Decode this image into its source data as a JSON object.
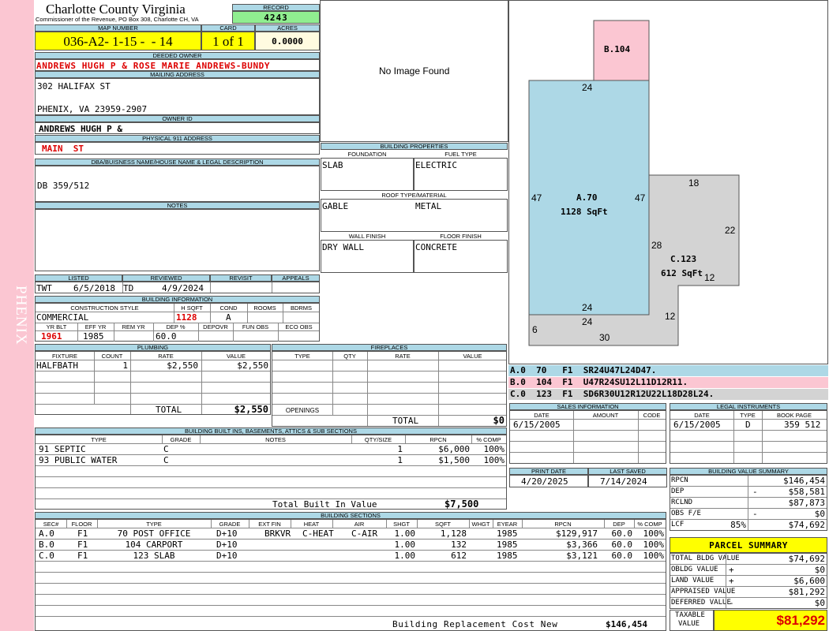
{
  "header": {
    "county": "Charlotte County Virginia",
    "commissioner": "Commissioner of the Revenue, PO Box 308, Charlotte CH, VA",
    "record_label": "RECORD",
    "record": "4243",
    "map_label": "MAP NUMBER",
    "map_number": "036-A2- 1-15 -  - 14",
    "card_label": "CARD",
    "card": "1 of 1",
    "acres_label": "ACRES",
    "acres": "0.0000"
  },
  "sidebar": {
    "label": "PHENIX"
  },
  "owner": {
    "deeded_label": "DEEDED OWNER",
    "deeded_owner": "ANDREWS HUGH P & ROSE MARIE ANDREWS-BUNDY",
    "mailing_label": "MAILING ADDRESS",
    "address1": "302 HALIFAX ST",
    "address2": "PHENIX, VA 23959-2907",
    "owner_id_label": "OWNER ID",
    "owner_id": "ANDREWS HUGH P &",
    "physical_label": "PHYSICAL 911 ADDRESS",
    "physical": "MAIN  ST",
    "dba_label": "DBA/BUISNESS NAME/HOUSE NAME & LEGAL DESCRIPTION",
    "dba": "DB 359/512",
    "notes_label": "NOTES"
  },
  "image": {
    "no_image": "No Image Found"
  },
  "building_props": {
    "title": "BUILDING PROPERTIES",
    "foundation_label": "FOUNDATION",
    "foundation": "SLAB",
    "fuel_label": "FUEL TYPE",
    "fuel": "ELECTRIC",
    "roof_label": "ROOF TYPE/MATERIAL",
    "roof_type": "GABLE",
    "roof_material": "METAL",
    "wall_label": "WALL FINISH",
    "wall": "DRY WALL",
    "floor_label": "FLOOR FINISH",
    "floor": "CONCRETE"
  },
  "listing": {
    "listed_label": "LISTED",
    "reviewed_label": "REVIEWED",
    "revisit_label": "REVISIT",
    "appeals_label": "APPEALS",
    "listed_by": "TWT",
    "listed_date": "6/5/2018",
    "reviewed_by": "TD",
    "reviewed_date": "4/9/2024"
  },
  "building_info": {
    "title": "BUILDING INFORMATION",
    "style_label": "CONSTRUCTION STYLE",
    "hsqft_label": "H SQFT",
    "cond_label": "COND",
    "rooms_label": "ROOMS",
    "bdrms_label": "BDRMS",
    "style": "COMMERCIAL",
    "hsqft": "1128",
    "cond": "A",
    "yrblt_label": "YR BLT",
    "effyr_label": "EFF YR",
    "remyr_label": "REM YR",
    "dep_label": "DEP %",
    "depovr_label": "DEPOVR",
    "funobs_label": "FUN OBS",
    "ecoobs_label": "ECO OBS",
    "yrblt": "1961",
    "effyr": "1985",
    "dep": "60.0"
  },
  "plumbing": {
    "title": "PLUMBING",
    "headers": [
      "FIXTURE",
      "COUNT",
      "RATE",
      "VALUE"
    ],
    "rows": [
      [
        "HALFBATH",
        "1",
        "$2,550",
        "$2,550"
      ]
    ],
    "total_label": "TOTAL",
    "total": "$2,550"
  },
  "fireplaces": {
    "title": "FIREPLACES",
    "headers": [
      "TYPE",
      "QTY",
      "RATE",
      "VALUE"
    ],
    "openings_label": "OPENINGS",
    "total_label": "TOTAL",
    "total": "$0"
  },
  "builtins": {
    "title": "BUILDING BUILT INS, BASEMENTS, ATTICS & SUB SECTIONS",
    "headers": [
      "TYPE",
      "GRADE",
      "NOTES",
      "QTY/SIZE",
      "RPCN",
      "% COMP"
    ],
    "rows": [
      [
        "91 SEPTIC",
        "C",
        "",
        "1",
        "$6,000",
        "100%"
      ],
      [
        "93 PUBLIC WATER",
        "C",
        "",
        "1",
        "$1,500",
        "100%"
      ]
    ],
    "total_label": "Total Built In Value",
    "total": "$7,500"
  },
  "sections": {
    "title": "BUILDING SECTIONS",
    "headers": [
      "SEC#",
      "FLOOR",
      "TYPE",
      "GRADE",
      "EXT FIN",
      "HEAT",
      "AIR",
      "SHGT",
      "SQFT",
      "WHGT",
      "EYEAR",
      "RPCN",
      "DEP",
      "% COMP"
    ],
    "rows": [
      [
        "A.0",
        "F1",
        "70 POST OFFICE",
        "D+10",
        "BRKVR",
        "C-HEAT",
        "C-AIR",
        "1.00",
        "1,128",
        "",
        "1985",
        "$129,917",
        "60.0",
        "100%"
      ],
      [
        "B.0",
        "F1",
        "104 CARPORT",
        "D+10",
        "",
        "",
        "",
        "1.00",
        "132",
        "",
        "1985",
        "$3,366",
        "60.0",
        "100%"
      ],
      [
        "C.0",
        "F1",
        "123 SLAB",
        "D+10",
        "",
        "",
        "",
        "1.00",
        "612",
        "",
        "1985",
        "$3,121",
        "60.0",
        "100%"
      ]
    ],
    "rcn_label": "Building Replacement Cost New",
    "rcn": "$146,454"
  },
  "sketch": {
    "a_label": "A.70",
    "a_area": "1128 SqFt",
    "b_label": "B.104",
    "c_label": "C.123",
    "c_area": "612 SqFt",
    "dims": [
      "24",
      "47",
      "47",
      "24",
      "18",
      "22",
      "28",
      "12",
      "12",
      "6",
      "24",
      "30"
    ]
  },
  "legend": [
    {
      "text": "A.0  70   F1  SR24U47L24D47.",
      "color": "#add8e6"
    },
    {
      "text": "B.0  104  F1  U47R24SU12L11D12R11.",
      "color": "#fbc6d2"
    },
    {
      "text": "C.0  123  F1  SD6R30U12R12U22L18D28L24.",
      "color": "#d3d3d3"
    }
  ],
  "sales": {
    "title": "SALES INFORMATION",
    "headers": [
      "DATE",
      "AMOUNT",
      "CODE"
    ],
    "rows": [
      [
        "6/15/2005",
        "",
        ""
      ]
    ]
  },
  "legal": {
    "title": "LEGAL INSTRUMENTS",
    "headers": [
      "DATE",
      "TYPE",
      "BOOK PAGE"
    ],
    "rows": [
      [
        "6/15/2005",
        "D",
        "359 512"
      ]
    ]
  },
  "dates": {
    "print_label": "PRINT DATE",
    "print": "4/20/2025",
    "saved_label": "LAST SAVED",
    "saved": "7/14/2024"
  },
  "value_summary": {
    "title": "BUILDING VALUE SUMMARY",
    "rows": [
      {
        "label": "RPCN",
        "sign": "",
        "pct": "",
        "value": "$146,454"
      },
      {
        "label": "DEP",
        "sign": "-",
        "pct": "",
        "value": "$58,581"
      },
      {
        "label": "RCLND",
        "sign": "",
        "pct": "",
        "value": "$87,873"
      },
      {
        "label": "OBS F/E",
        "sign": "-",
        "pct": "",
        "value": "$0"
      },
      {
        "label": "LCF",
        "sign": "",
        "pct": "85%",
        "value": "$74,692"
      }
    ]
  },
  "parcel": {
    "title": "PARCEL SUMMARY",
    "rows": [
      {
        "label": "TOTAL BLDG VALUE",
        "sign": "",
        "value": "$74,692"
      },
      {
        "label": "OBLDG VALUE",
        "sign": "+",
        "value": "$0"
      },
      {
        "label": "LAND VALUE",
        "sign": "+",
        "value": "$6,600"
      },
      {
        "label": "APPRAISED VALUE",
        "sign": "",
        "value": "$81,292"
      },
      {
        "label": "DEFERRED VALUE",
        "sign": "-",
        "value": "$0"
      }
    ],
    "taxable_label1": "TAXABLE",
    "taxable_label2": "VALUE",
    "taxable": "$81,292"
  },
  "colors": {
    "header": "#add8e6",
    "yellow": "#ffff00",
    "green": "#90ee90",
    "pink": "#fbc6d2",
    "red": "#dd0000"
  }
}
